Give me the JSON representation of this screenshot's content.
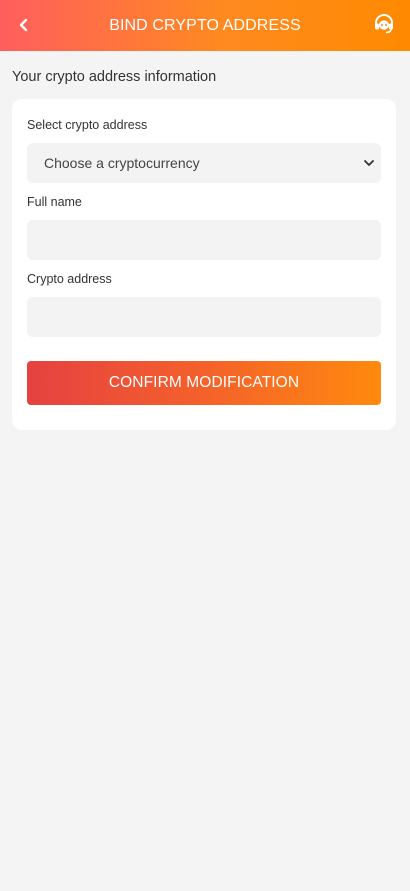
{
  "header": {
    "title": "BIND CRYPTO ADDRESS",
    "back_icon": "chevron-left-icon",
    "support_icon": "headset-icon",
    "gradient_start": "#ff5e5e",
    "gradient_end": "#ff8a00"
  },
  "section": {
    "title": "Your crypto address information"
  },
  "form": {
    "crypto_select": {
      "label": "Select crypto address",
      "selected_value": "Choose a cryptocurrency",
      "icon": "chevron-down-icon"
    },
    "full_name": {
      "label": "Full name",
      "value": "",
      "placeholder": ""
    },
    "crypto_address": {
      "label": "Crypto address",
      "value": "",
      "placeholder": ""
    },
    "confirm_label": "CONFIRM MODIFICATION",
    "confirm_gradient_start": "#e54141",
    "confirm_gradient_end": "#ff8a0d"
  }
}
